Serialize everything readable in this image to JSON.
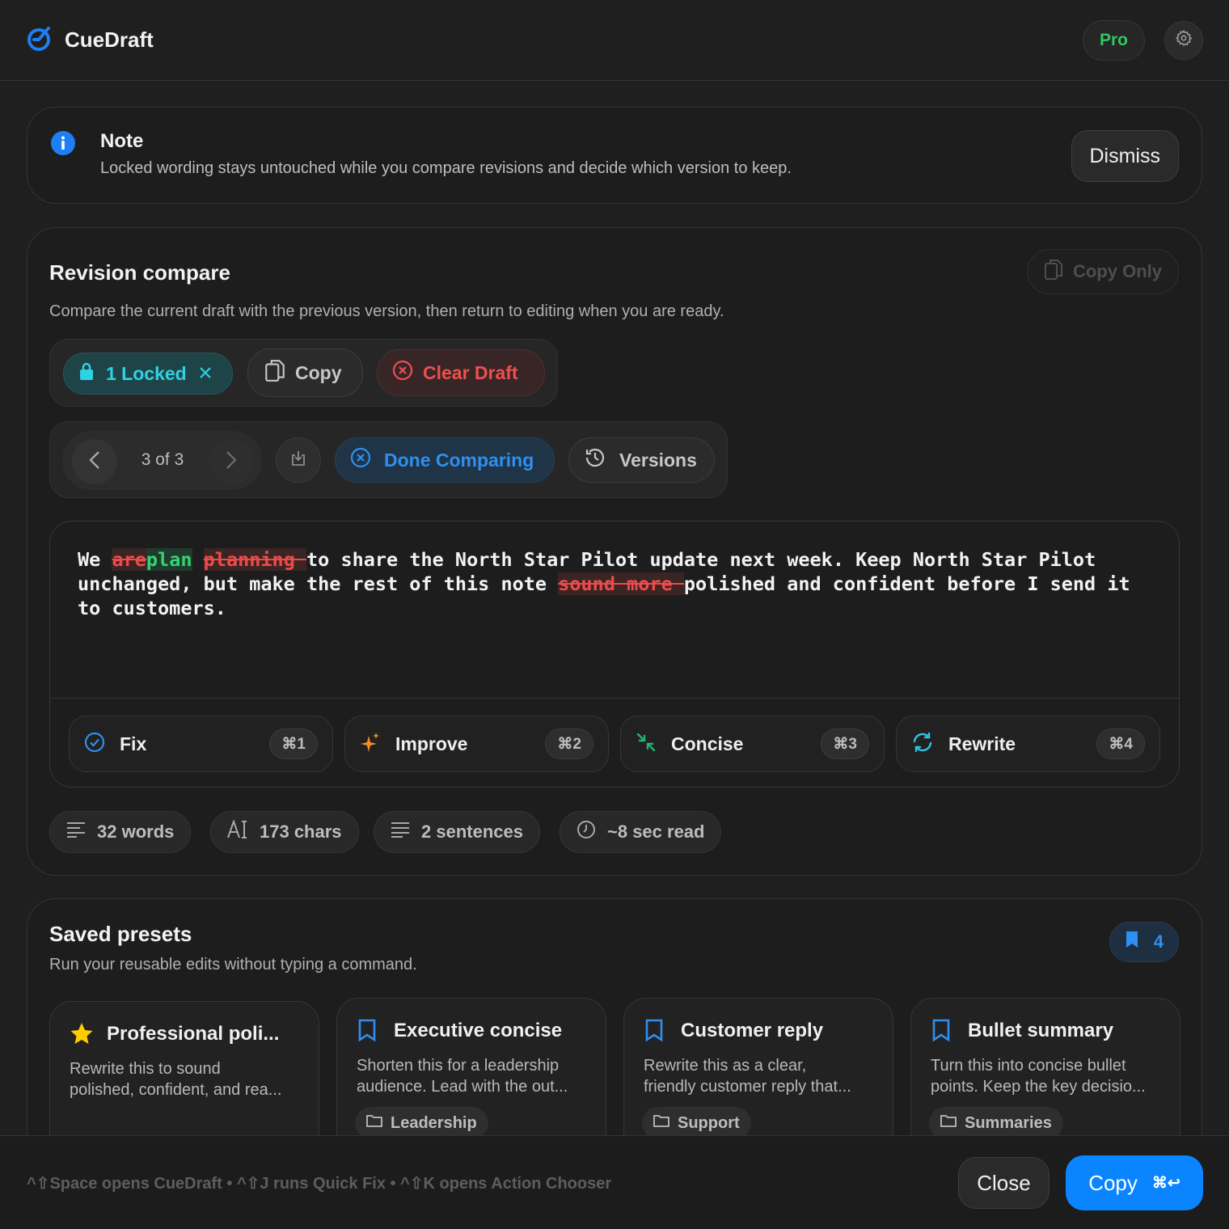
{
  "app": {
    "name": "CueDraft",
    "plan_badge": "Pro"
  },
  "note": {
    "title": "Note",
    "text": "Locked wording stays untouched while you compare revisions and decide which version to keep.",
    "dismiss_label": "Dismiss"
  },
  "revision": {
    "title": "Revision compare",
    "subtitle": "Compare the current draft with the previous version, then return to editing when you are ready.",
    "copy_only_label": "Copy Only",
    "toolbar": {
      "locked_label": "1 Locked",
      "copy_label": "Copy",
      "clear_label": "Clear Draft",
      "position": "3 of 3",
      "done_label": "Done Comparing",
      "versions_label": "Versions"
    },
    "diff": [
      {
        "t": "We ",
        "k": ""
      },
      {
        "t": "are",
        "k": "del"
      },
      {
        "t": "plan",
        "k": "ins"
      },
      {
        "t": " ",
        "k": ""
      },
      {
        "t": "planning ",
        "k": "del"
      },
      {
        "t": "to share the North Star Pilot update next week. Keep North Star Pilot unchanged, but make the rest of this note ",
        "k": ""
      },
      {
        "t": "sound more ",
        "k": "del"
      },
      {
        "t": "polished and confident before I send it to customers.",
        "k": ""
      }
    ],
    "actions": [
      {
        "label": "Fix",
        "shortcut": "⌘1"
      },
      {
        "label": "Improve",
        "shortcut": "⌘2"
      },
      {
        "label": "Concise",
        "shortcut": "⌘3"
      },
      {
        "label": "Rewrite",
        "shortcut": "⌘4"
      }
    ],
    "stats": {
      "words": "32 words",
      "chars": "173 chars",
      "sentences": "2 sentences",
      "read_time": "~8 sec read"
    }
  },
  "presets": {
    "title": "Saved presets",
    "subtitle": "Run your reusable edits without typing a command.",
    "count": "4",
    "items": [
      {
        "title": "Professional poli...",
        "desc1": "Rewrite this to sound",
        "desc2": "polished, confident, and rea...",
        "tag": ""
      },
      {
        "title": "Executive concise",
        "desc1": "Shorten this for a leadership",
        "desc2": "audience. Lead with the out...",
        "tag": "Leadership"
      },
      {
        "title": "Customer reply",
        "desc1": "Rewrite this as a clear,",
        "desc2": "friendly customer reply that...",
        "tag": "Support"
      },
      {
        "title": "Bullet summary",
        "desc1": "Turn this into concise bullet",
        "desc2": "points. Keep the key decisio...",
        "tag": "Summaries"
      }
    ]
  },
  "footer": {
    "hint": "^⇧Space opens CueDraft • ^⇧J runs Quick Fix • ^⇧K opens Action Chooser",
    "close_label": "Close",
    "copy_label": "Copy",
    "copy_shortcut": "⌘↩"
  },
  "colors": {
    "accent": "#0a84ff",
    "teal": "#2fd1e3",
    "danger": "#ef4f4f",
    "success": "#2ec862"
  }
}
